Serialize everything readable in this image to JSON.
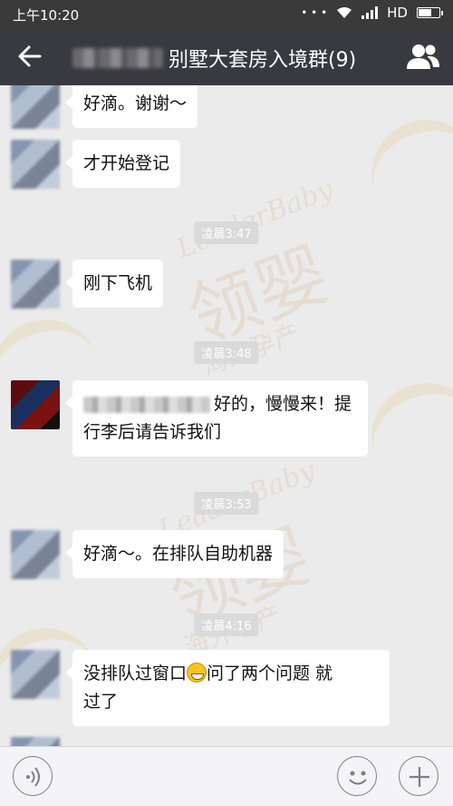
{
  "status_bar": {
    "time": "上午10:20",
    "network": "HD"
  },
  "header": {
    "title": "别墅大套房入境群(9)"
  },
  "messages": [
    {
      "text": "好滴。谢谢～"
    },
    {
      "text": "才开始登记"
    },
    {
      "text": "刚下飞机"
    },
    {
      "line1": "好的，慢慢来！提",
      "line2": "行李后请告诉我们"
    },
    {
      "text": "好滴～。在排队自助机器"
    },
    {
      "line1_before": "没排队过窗口",
      "line1_after": "问了两个问题 就",
      "line2": "过了"
    }
  ],
  "time_labels": [
    "凌晨3:47",
    "凌晨3:48",
    "凌晨3:53",
    "凌晨4:16"
  ],
  "watermark": {
    "brand": "LeaderBaby",
    "logo": "领婴",
    "slogan": "海外孕产"
  }
}
